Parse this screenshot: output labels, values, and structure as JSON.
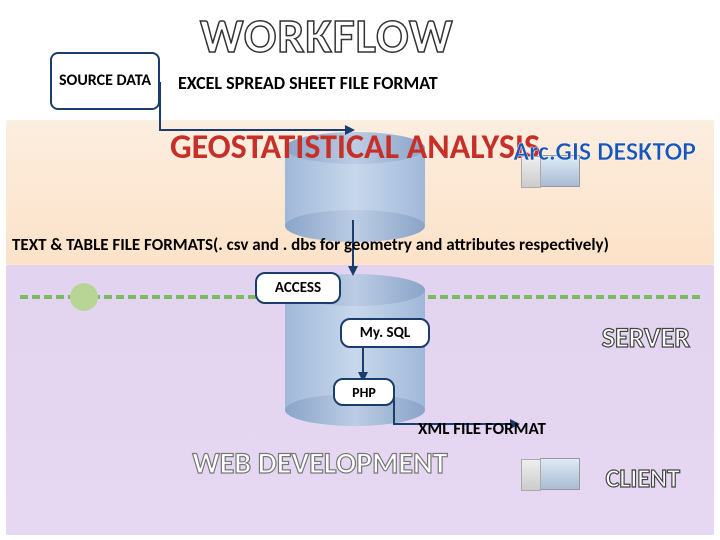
{
  "title": "WORKFLOW",
  "source_box": "SOURCE DATA",
  "excel_label": "EXCEL SPREAD SHEET FILE FORMAT",
  "geo_heading": "GEOSTATISTICAL ANALYSIS",
  "arcgis": "Arc.GIS DESKTOP",
  "text_table": "TEXT & TABLE FILE FORMATS(. csv and . dbs for geometry and attributes respectively)",
  "nodes": {
    "access": "ACCESS",
    "mysql": "My. SQL",
    "php": "PHP"
  },
  "server": "SERVER",
  "xml": "XML FILE FORMAT",
  "webdev": "WEB DEVELOPMENT",
  "client": "CLIENT"
}
